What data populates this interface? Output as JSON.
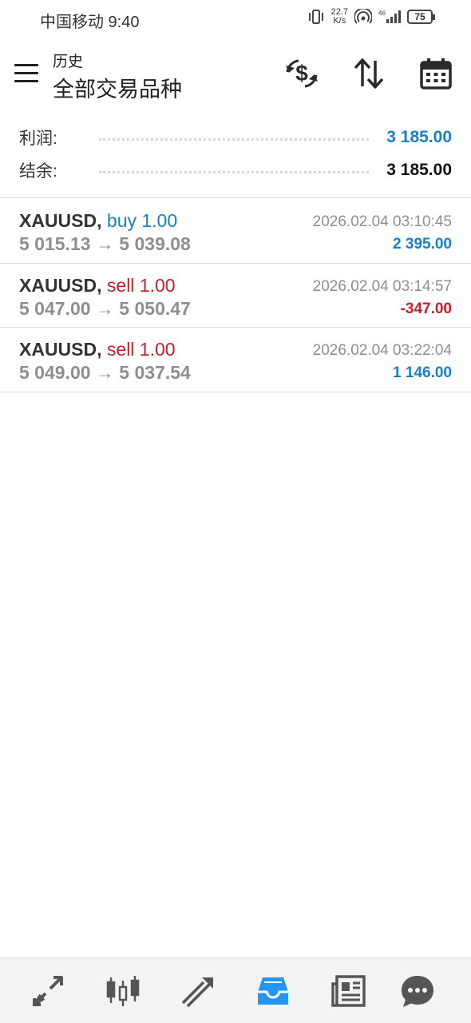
{
  "status_bar": {
    "carrier_time": "中国移动 9:40",
    "net_speed_value": "22.7",
    "net_speed_unit": "K/s",
    "battery": "75"
  },
  "header": {
    "subtitle": "历史",
    "title": "全部交易品种",
    "icons": [
      "currency-exchange-icon",
      "sort-icon",
      "calendar-icon"
    ]
  },
  "summary": {
    "profit_label": "利润:",
    "profit_value": "3 185.00",
    "balance_label": "结余:",
    "balance_value": "3 185.00"
  },
  "colors": {
    "buy": "#1a7fc9",
    "sell": "#c8202a",
    "accent": "#2196f3",
    "muted": "#8e8e8e"
  },
  "deals": [
    {
      "symbol": "XAUUSD,",
      "type_volume": "buy 1.00",
      "direction": "buy",
      "prices": "5 015.13 → 5 039.08",
      "time": "2026.02.04 03:10:45",
      "profit": "2 395.00"
    },
    {
      "symbol": "XAUUSD,",
      "type_volume": "sell 1.00",
      "direction": "sell",
      "prices": "5 047.00 → 5 050.47",
      "time": "2026.02.04 03:14:57",
      "profit": "-347.00"
    },
    {
      "symbol": "XAUUSD,",
      "type_volume": "sell 1.00",
      "direction": "sell",
      "prices": "5 049.00 → 5 037.54",
      "time": "2026.02.04 03:22:04",
      "profit": "1 146.00"
    }
  ],
  "bottom_nav": {
    "items": [
      "quotes-icon",
      "chart-icon",
      "trade-icon",
      "history-icon",
      "news-icon",
      "chat-icon"
    ],
    "active": "history-icon"
  }
}
